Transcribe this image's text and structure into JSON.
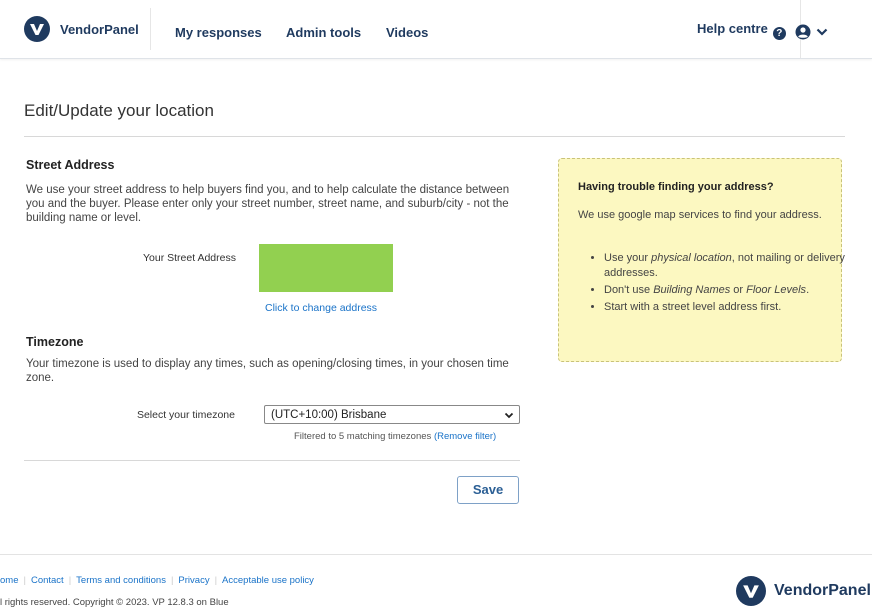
{
  "header": {
    "brand": "VendorPanel",
    "nav": [
      "My responses",
      "Admin tools",
      "Videos"
    ],
    "help_label": "Help centre"
  },
  "page": {
    "title": "Edit/Update your location"
  },
  "street": {
    "title": "Street Address",
    "description": "We use your street address to help buyers find you, and to help calculate the distance between you and the buyer. Please enter only your street number, street name, and suburb/city - not the building name or level.",
    "field_label": "Your Street Address",
    "change_link": "Click to change address"
  },
  "timezone": {
    "title": "Timezone",
    "description": "Your timezone is used to display any times, such as opening/closing times, in your chosen time zone.",
    "field_label": "Select your timezone",
    "selected": "(UTC+10:00) Brisbane",
    "filter_note": "Filtered to 5 matching timezones",
    "remove_filter": "(Remove filter)"
  },
  "save_label": "Save",
  "tip": {
    "title": "Having trouble finding your address?",
    "text": "We use google map services to find your address.",
    "item1_a": "Use your ",
    "item1_em": "physical location",
    "item1_b": ", not mailing or delivery addresses.",
    "item2_a": "Don't use ",
    "item2_em1": "Building Names",
    "item2_mid": " or ",
    "item2_em2": "Floor Levels",
    "item2_b": ".",
    "item3": "Start with a street level address first."
  },
  "footer": {
    "links": [
      "ome",
      "Contact",
      "Terms and conditions",
      "Privacy",
      "Acceptable use policy"
    ],
    "copyright": "l rights reserved. Copyright © 2023. VP 12.8.3 on Blue",
    "brand": "VendorPanel"
  },
  "colors": {
    "brand": "#1f3a5f",
    "link": "#1a73c8",
    "address_preview": "#92d050",
    "tip_background": "#fcf8c1"
  },
  "icons": [
    "vendorpanel-logo-icon",
    "question-circle-icon",
    "user-circle-icon",
    "chevron-down-icon"
  ]
}
